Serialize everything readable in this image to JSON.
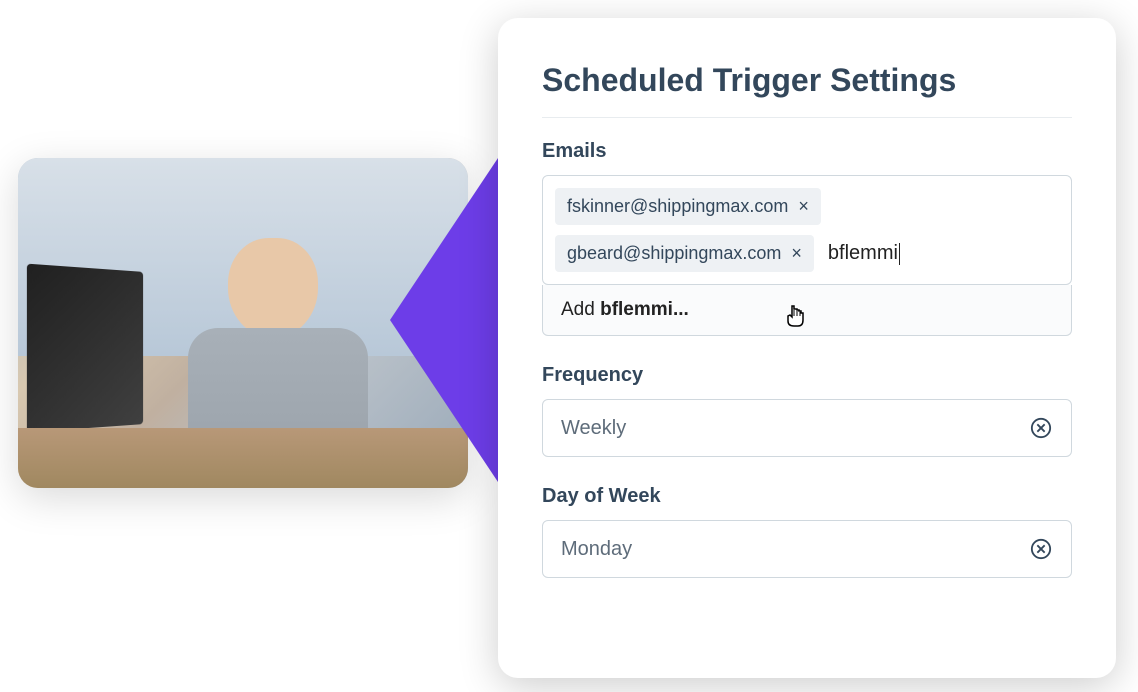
{
  "panel": {
    "title": "Scheduled Trigger Settings",
    "emails": {
      "label": "Emails",
      "chips": [
        "fskinner@shippingmax.com",
        "gbeard@shippingmax.com"
      ],
      "typing": "bflemmi",
      "suggestion_prefix": "Add ",
      "suggestion_bold": "bflemmi...",
      "suggestion_full": "Add bflemmi..."
    },
    "frequency": {
      "label": "Frequency",
      "value": "Weekly"
    },
    "day_of_week": {
      "label": "Day of Week",
      "value": "Monday"
    }
  }
}
